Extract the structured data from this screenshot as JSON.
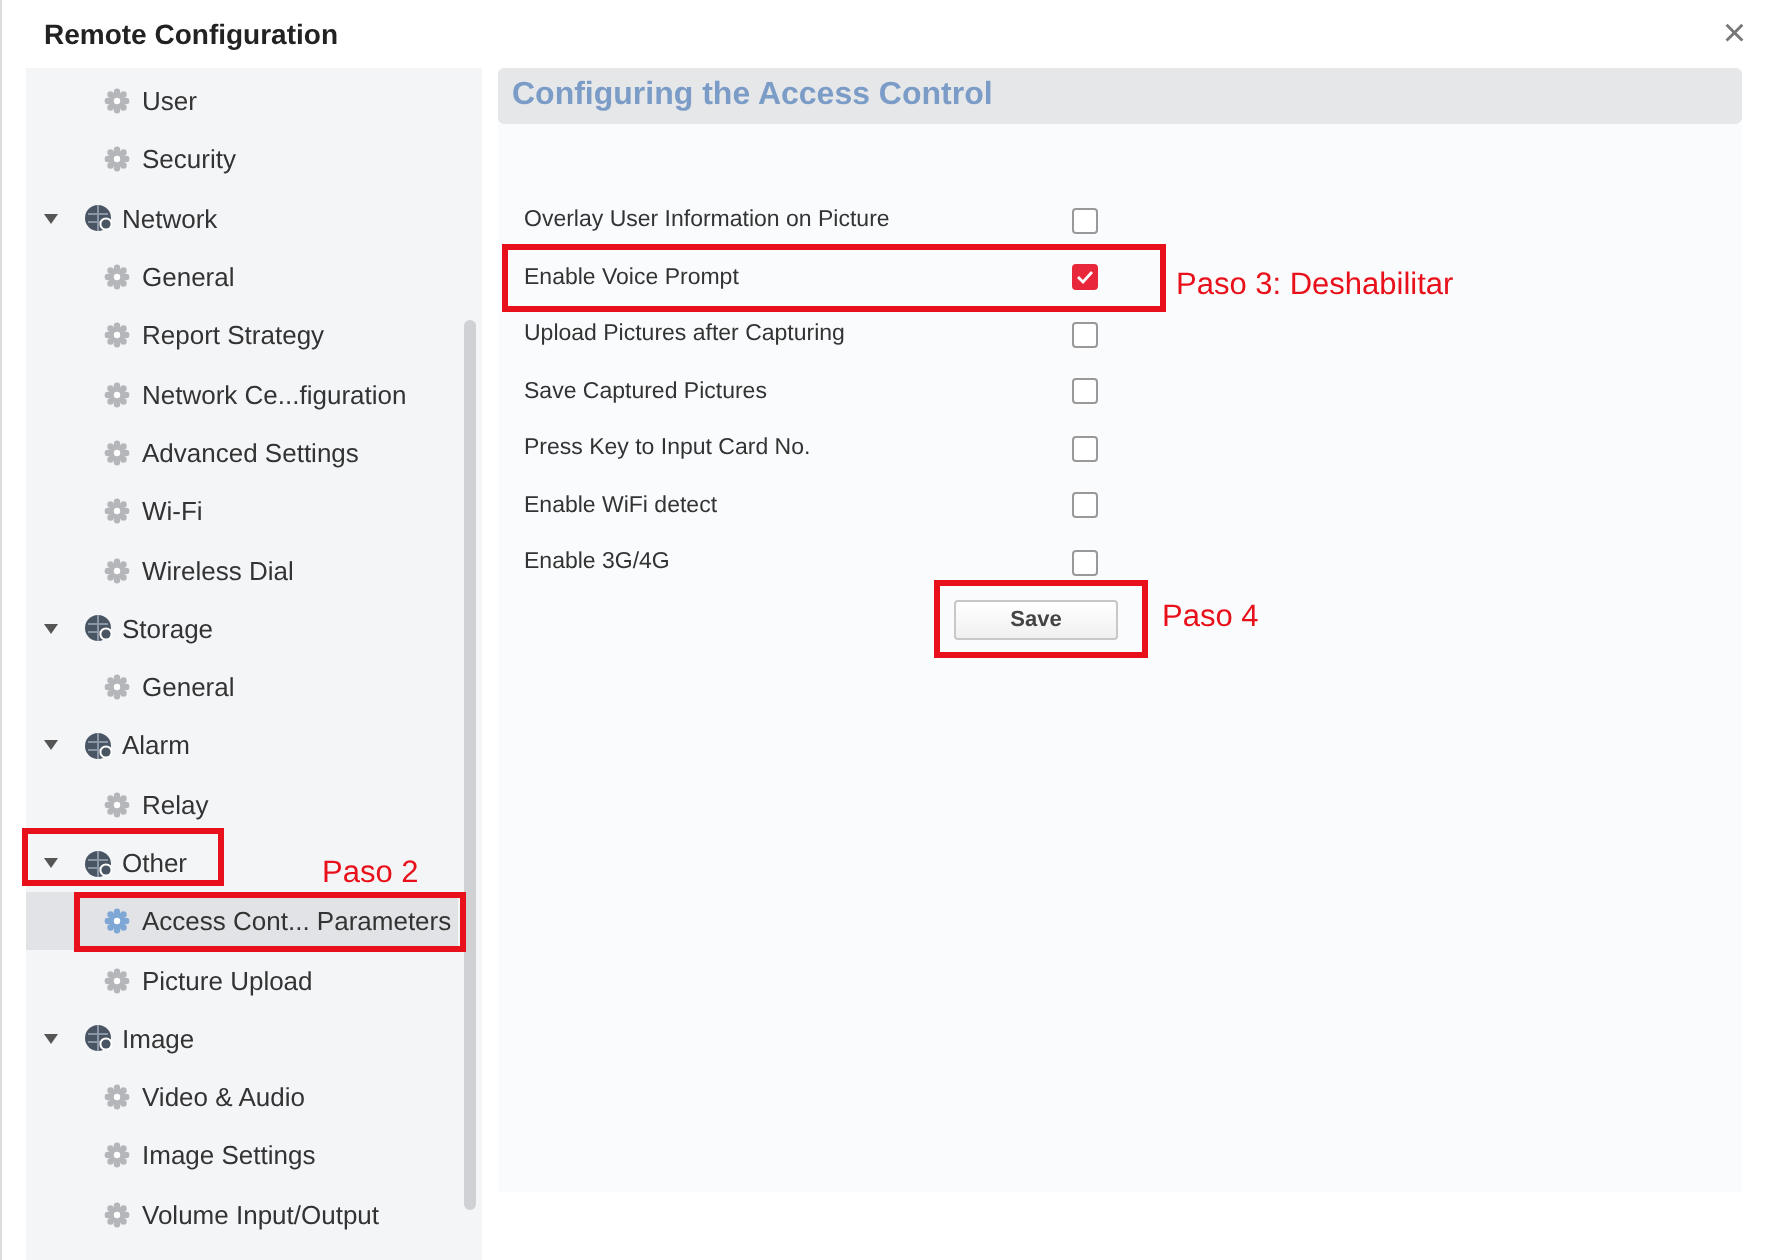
{
  "window": {
    "title": "Remote Configuration",
    "close": "×"
  },
  "sidebar": {
    "items": [
      {
        "children": [
          {
            "label": "User",
            "selected": false
          },
          {
            "label": "Security",
            "selected": false
          }
        ]
      },
      {
        "label": "Network",
        "expanded": true,
        "children": [
          {
            "label": "General",
            "selected": false
          },
          {
            "label": "Report Strategy",
            "selected": false
          },
          {
            "label": "Network Ce...figuration",
            "selected": false
          },
          {
            "label": "Advanced Settings",
            "selected": false
          },
          {
            "label": "Wi-Fi",
            "selected": false
          },
          {
            "label": "Wireless Dial",
            "selected": false
          }
        ]
      },
      {
        "label": "Storage",
        "expanded": true,
        "children": [
          {
            "label": "General",
            "selected": false
          }
        ]
      },
      {
        "label": "Alarm",
        "expanded": true,
        "children": [
          {
            "label": "Relay",
            "selected": false
          }
        ]
      },
      {
        "label": "Other",
        "expanded": true,
        "children": [
          {
            "label": "Access Cont... Parameters",
            "selected": true
          },
          {
            "label": "Picture Upload",
            "selected": false
          }
        ]
      },
      {
        "label": "Image",
        "expanded": true,
        "children": [
          {
            "label": "Video & Audio",
            "selected": false
          },
          {
            "label": "Image Settings",
            "selected": false
          },
          {
            "label": "Volume Input/Output",
            "selected": false
          }
        ]
      }
    ]
  },
  "panel": {
    "title": "Configuring the Access Control",
    "options": [
      {
        "label": "Overlay User Information on Picture",
        "checked": false
      },
      {
        "label": "Enable Voice Prompt",
        "checked": true
      },
      {
        "label": "Upload Pictures after Capturing",
        "checked": false
      },
      {
        "label": "Save Captured Pictures",
        "checked": false
      },
      {
        "label": "Press Key to Input Card No.",
        "checked": false
      },
      {
        "label": "Enable WiFi detect",
        "checked": false
      },
      {
        "label": "Enable 3G/4G",
        "checked": false
      }
    ],
    "save_button": "Save"
  },
  "annotations": [
    "Paso 2",
    "Paso 3: Deshabilitar",
    "Paso 4"
  ]
}
